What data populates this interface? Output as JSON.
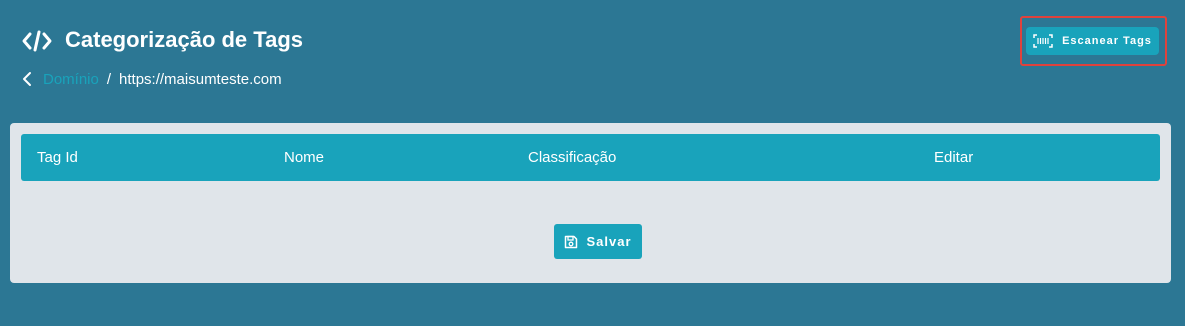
{
  "header": {
    "icon": "code-icon",
    "title": "Categorização de Tags"
  },
  "breadcrumb": {
    "back_icon": "chevron-left-icon",
    "link": "Domínio",
    "separator": "/",
    "current": "https://maisumteste.com"
  },
  "actions": {
    "scan_icon": "barcode-scan-icon",
    "scan_label": "Escanear Tags"
  },
  "table": {
    "columns": [
      "Tag Id",
      "Nome",
      "Classificação",
      "Editar"
    ],
    "rows": []
  },
  "form": {
    "save_icon": "floppy-disk-icon",
    "save_label": "Salvar"
  },
  "colors": {
    "background": "#2c7794",
    "accent": "#19a3bb",
    "card": "#e0e5ea",
    "highlight": "#e0423c"
  }
}
